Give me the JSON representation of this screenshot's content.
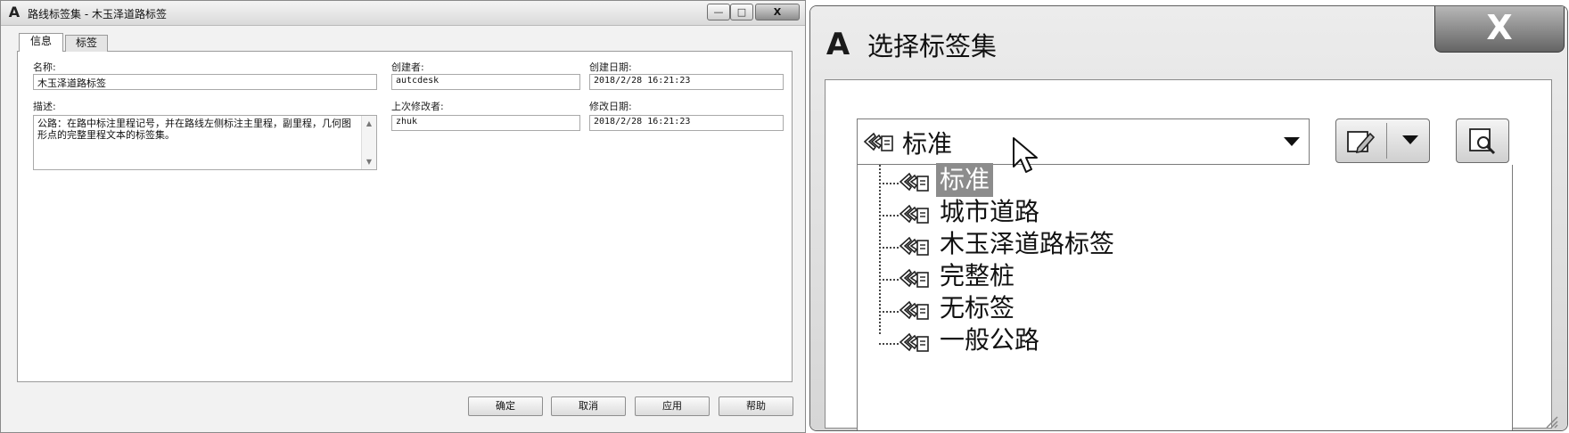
{
  "left_dialog": {
    "title": "路线标签集 - 木玉泽道路标签",
    "app_icon": "A",
    "caption_buttons": {
      "minimize": "—",
      "maximize": "□",
      "close": "X"
    },
    "tabs": [
      {
        "label": "信息",
        "active": true
      },
      {
        "label": "标签",
        "active": false
      }
    ],
    "fields": {
      "name": {
        "label": "名称:",
        "value": "木玉泽道路标签"
      },
      "created_by": {
        "label": "创建者:",
        "value": "autcdesk"
      },
      "created_date": {
        "label": "创建日期:",
        "value": "2018/2/28 16:21:23"
      },
      "description": {
        "label": "描述:",
        "value": "公路：在路中标注里程记号，并在路线左侧标注主里程，副里程，几何图形点的完整里程文本的标签集。"
      },
      "modified_by": {
        "label": "上次修改者:",
        "value": "zhuk"
      },
      "modified_date": {
        "label": "修改日期:",
        "value": "2018/2/28 16:21:23"
      }
    },
    "buttons": {
      "ok": "确定",
      "cancel": "取消",
      "apply": "应用",
      "help": "帮助"
    }
  },
  "right_dialog": {
    "title": "选择标签集",
    "app_icon": "A",
    "close_label": "X",
    "combo": {
      "selected": "标准",
      "icon": "label-set-icon"
    },
    "toolbar": {
      "edit_icon": "edit-icon",
      "dropdown_icon": "chevron-down-icon",
      "browse_icon": "preview-icon"
    },
    "tree_items": [
      {
        "label": "标准",
        "selected": true
      },
      {
        "label": "城市道路",
        "selected": false
      },
      {
        "label": "木玉泽道路标签",
        "selected": false
      },
      {
        "label": "完整桩",
        "selected": false
      },
      {
        "label": "无标签",
        "selected": false
      },
      {
        "label": "一般公路",
        "selected": false
      }
    ]
  }
}
